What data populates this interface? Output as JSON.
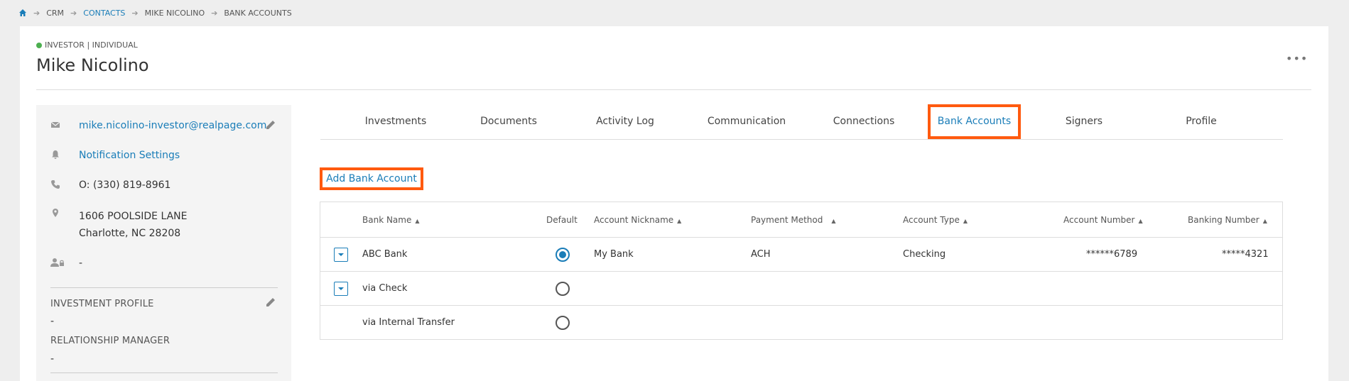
{
  "breadcrumb": {
    "items": [
      "CRM",
      "CONTACTS",
      "MIKE NICOLINO",
      "BANK ACCOUNTS"
    ]
  },
  "contact": {
    "type": "INVESTOR | INDIVIDUAL",
    "name": "Mike Nicolino",
    "more_label": "•••"
  },
  "sidebar": {
    "email": "mike.nicolino-investor@realpage.com",
    "notification_settings": "Notification Settings",
    "phone": "O: (330) 819-8961",
    "address_line1": "1606 POOLSIDE LANE",
    "address_line2": "Charlotte, NC 28208",
    "user_value": "-",
    "investment_profile_label": "INVESTMENT PROFILE",
    "investment_profile_value": "-",
    "relationship_manager_label": "RELATIONSHIP MANAGER",
    "relationship_manager_value": "-"
  },
  "tabs": [
    {
      "label": "Investments"
    },
    {
      "label": "Documents"
    },
    {
      "label": "Activity Log"
    },
    {
      "label": "Communication"
    },
    {
      "label": "Connections"
    },
    {
      "label": "Bank Accounts"
    },
    {
      "label": "Signers"
    },
    {
      "label": "Profile"
    }
  ],
  "active_tab": "Bank Accounts",
  "add_button_label": "Add Bank Account",
  "table": {
    "headers": {
      "bank_name": "Bank Name",
      "default": "Default",
      "account_nickname": "Account Nickname",
      "payment_method": "Payment Method",
      "account_type": "Account Type",
      "account_number": "Account Number",
      "banking_number": "Banking Number"
    },
    "rows": [
      {
        "bank_name": "ABC Bank",
        "default": true,
        "account_nickname": "My Bank",
        "payment_method": "ACH",
        "account_type": "Checking",
        "account_number": "******6789",
        "banking_number": "*****4321",
        "expandable": true
      },
      {
        "bank_name": "via Check",
        "default": false,
        "account_nickname": "",
        "payment_method": "",
        "account_type": "",
        "account_number": "",
        "banking_number": "",
        "expandable": true
      },
      {
        "bank_name": "via Internal Transfer",
        "default": false,
        "account_nickname": "",
        "payment_method": "",
        "account_type": "",
        "account_number": "",
        "banking_number": "",
        "expandable": false
      }
    ]
  },
  "colors": {
    "accent": "#1a7db8",
    "highlight": "#ff5a0f",
    "status_green": "#4caf50"
  }
}
